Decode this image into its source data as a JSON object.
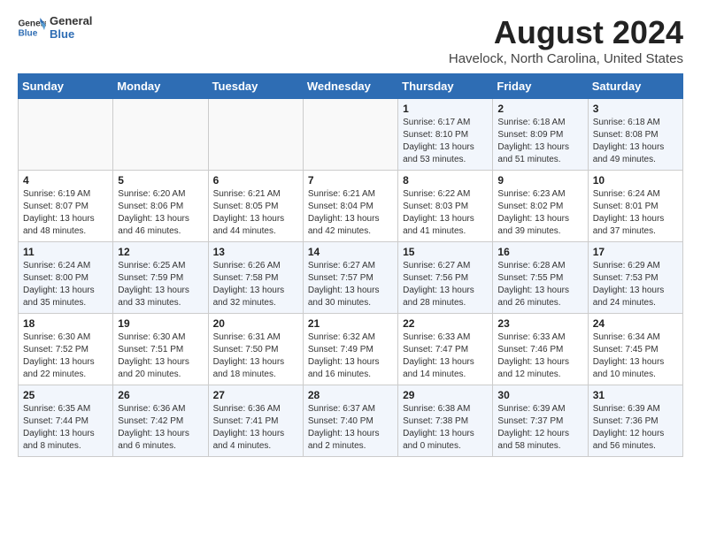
{
  "logo": {
    "line1": "General",
    "line2": "Blue"
  },
  "title": "August 2024",
  "location": "Havelock, North Carolina, United States",
  "weekdays": [
    "Sunday",
    "Monday",
    "Tuesday",
    "Wednesday",
    "Thursday",
    "Friday",
    "Saturday"
  ],
  "weeks": [
    [
      {
        "day": "",
        "content": ""
      },
      {
        "day": "",
        "content": ""
      },
      {
        "day": "",
        "content": ""
      },
      {
        "day": "",
        "content": ""
      },
      {
        "day": "1",
        "content": "Sunrise: 6:17 AM\nSunset: 8:10 PM\nDaylight: 13 hours\nand 53 minutes."
      },
      {
        "day": "2",
        "content": "Sunrise: 6:18 AM\nSunset: 8:09 PM\nDaylight: 13 hours\nand 51 minutes."
      },
      {
        "day": "3",
        "content": "Sunrise: 6:18 AM\nSunset: 8:08 PM\nDaylight: 13 hours\nand 49 minutes."
      }
    ],
    [
      {
        "day": "4",
        "content": "Sunrise: 6:19 AM\nSunset: 8:07 PM\nDaylight: 13 hours\nand 48 minutes."
      },
      {
        "day": "5",
        "content": "Sunrise: 6:20 AM\nSunset: 8:06 PM\nDaylight: 13 hours\nand 46 minutes."
      },
      {
        "day": "6",
        "content": "Sunrise: 6:21 AM\nSunset: 8:05 PM\nDaylight: 13 hours\nand 44 minutes."
      },
      {
        "day": "7",
        "content": "Sunrise: 6:21 AM\nSunset: 8:04 PM\nDaylight: 13 hours\nand 42 minutes."
      },
      {
        "day": "8",
        "content": "Sunrise: 6:22 AM\nSunset: 8:03 PM\nDaylight: 13 hours\nand 41 minutes."
      },
      {
        "day": "9",
        "content": "Sunrise: 6:23 AM\nSunset: 8:02 PM\nDaylight: 13 hours\nand 39 minutes."
      },
      {
        "day": "10",
        "content": "Sunrise: 6:24 AM\nSunset: 8:01 PM\nDaylight: 13 hours\nand 37 minutes."
      }
    ],
    [
      {
        "day": "11",
        "content": "Sunrise: 6:24 AM\nSunset: 8:00 PM\nDaylight: 13 hours\nand 35 minutes."
      },
      {
        "day": "12",
        "content": "Sunrise: 6:25 AM\nSunset: 7:59 PM\nDaylight: 13 hours\nand 33 minutes."
      },
      {
        "day": "13",
        "content": "Sunrise: 6:26 AM\nSunset: 7:58 PM\nDaylight: 13 hours\nand 32 minutes."
      },
      {
        "day": "14",
        "content": "Sunrise: 6:27 AM\nSunset: 7:57 PM\nDaylight: 13 hours\nand 30 minutes."
      },
      {
        "day": "15",
        "content": "Sunrise: 6:27 AM\nSunset: 7:56 PM\nDaylight: 13 hours\nand 28 minutes."
      },
      {
        "day": "16",
        "content": "Sunrise: 6:28 AM\nSunset: 7:55 PM\nDaylight: 13 hours\nand 26 minutes."
      },
      {
        "day": "17",
        "content": "Sunrise: 6:29 AM\nSunset: 7:53 PM\nDaylight: 13 hours\nand 24 minutes."
      }
    ],
    [
      {
        "day": "18",
        "content": "Sunrise: 6:30 AM\nSunset: 7:52 PM\nDaylight: 13 hours\nand 22 minutes."
      },
      {
        "day": "19",
        "content": "Sunrise: 6:30 AM\nSunset: 7:51 PM\nDaylight: 13 hours\nand 20 minutes."
      },
      {
        "day": "20",
        "content": "Sunrise: 6:31 AM\nSunset: 7:50 PM\nDaylight: 13 hours\nand 18 minutes."
      },
      {
        "day": "21",
        "content": "Sunrise: 6:32 AM\nSunset: 7:49 PM\nDaylight: 13 hours\nand 16 minutes."
      },
      {
        "day": "22",
        "content": "Sunrise: 6:33 AM\nSunset: 7:47 PM\nDaylight: 13 hours\nand 14 minutes."
      },
      {
        "day": "23",
        "content": "Sunrise: 6:33 AM\nSunset: 7:46 PM\nDaylight: 13 hours\nand 12 minutes."
      },
      {
        "day": "24",
        "content": "Sunrise: 6:34 AM\nSunset: 7:45 PM\nDaylight: 13 hours\nand 10 minutes."
      }
    ],
    [
      {
        "day": "25",
        "content": "Sunrise: 6:35 AM\nSunset: 7:44 PM\nDaylight: 13 hours\nand 8 minutes."
      },
      {
        "day": "26",
        "content": "Sunrise: 6:36 AM\nSunset: 7:42 PM\nDaylight: 13 hours\nand 6 minutes."
      },
      {
        "day": "27",
        "content": "Sunrise: 6:36 AM\nSunset: 7:41 PM\nDaylight: 13 hours\nand 4 minutes."
      },
      {
        "day": "28",
        "content": "Sunrise: 6:37 AM\nSunset: 7:40 PM\nDaylight: 13 hours\nand 2 minutes."
      },
      {
        "day": "29",
        "content": "Sunrise: 6:38 AM\nSunset: 7:38 PM\nDaylight: 13 hours\nand 0 minutes."
      },
      {
        "day": "30",
        "content": "Sunrise: 6:39 AM\nSunset: 7:37 PM\nDaylight: 12 hours\nand 58 minutes."
      },
      {
        "day": "31",
        "content": "Sunrise: 6:39 AM\nSunset: 7:36 PM\nDaylight: 12 hours\nand 56 minutes."
      }
    ]
  ]
}
